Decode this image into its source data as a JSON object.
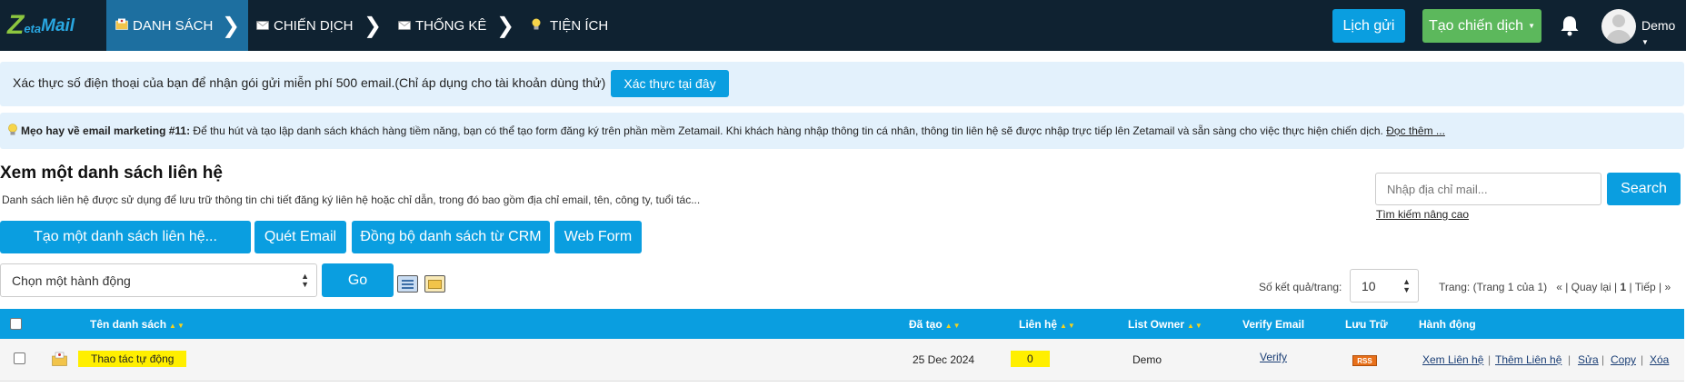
{
  "brand": {
    "logo_z": "Z",
    "logo_eta": "eta",
    "logo_mail": "Mail"
  },
  "nav": {
    "items": [
      {
        "label": "DANH SÁCH",
        "icon": "contacts-folder-icon",
        "active": true
      },
      {
        "label": "CHIẾN DỊCH",
        "icon": "envelope-icon",
        "active": false
      },
      {
        "label": "THỐNG KÊ",
        "icon": "envelope-icon",
        "active": false
      },
      {
        "label": "TIỆN ÍCH",
        "icon": "lightbulb-icon",
        "active": false
      }
    ]
  },
  "header": {
    "schedule_label": "Lịch gửi",
    "create_campaign_label": "Tạo chiến dịch",
    "user_name": "Demo"
  },
  "alert_verify": {
    "text": "Xác thực số điện thoại của bạn để nhận gói gửi miễn phí 500 email.(Chỉ áp dụng cho tài khoản dùng thử)",
    "button": "Xác thực tại đây"
  },
  "tip": {
    "title": "Mẹo hay về email marketing #11:",
    "text": " Để thu hút và tạo lập danh sách khách hàng tiềm năng, bạn có thể tạo form đăng ký trên phần mềm Zetamail. Khi khách hàng nhập thông tin cá nhân, thông tin liên hệ sẽ được nhập trực tiếp lên Zetamail và sẵn sàng cho việc thực hiện chiến dịch.",
    "more": "Đọc thêm ..."
  },
  "page": {
    "title": "Xem một danh sách liên hệ",
    "description": "Danh sách liên hệ được sử dụng để lưu trữ thông tin chi tiết đăng ký liên hệ hoặc chỉ dẫn, trong đó bao gồm địa chỉ email, tên, công ty, tuổi tác..."
  },
  "search": {
    "placeholder": "Nhập địa chỉ mail...",
    "button": "Search",
    "advanced": "Tìm kiếm nâng cao"
  },
  "actions": {
    "create_list": "Tạo một danh sách liên hệ...",
    "scan_email": "Quét Email",
    "sync_crm": "Đồng bộ danh sách từ CRM",
    "web_form": "Web Form",
    "bulk_select": "Chọn một hành động",
    "go": "Go"
  },
  "paging": {
    "per_page_label": "Số kết quả/trang:",
    "per_page_value": "10",
    "page_info": "Trang: (Trang 1 của 1)",
    "first": "«",
    "prev": "Quay lại",
    "current": "1",
    "next": "Tiếp",
    "last": "»"
  },
  "table": {
    "columns": {
      "name": "Tên danh sách",
      "created": "Đã tạo",
      "contacts": "Liên hệ",
      "owner": "List Owner",
      "verify": "Verify Email",
      "archive": "Lưu Trữ",
      "actions": "Hành động"
    },
    "rows": [
      {
        "name": "Thao tác tự động",
        "created": "25 Dec 2024",
        "contacts": "0",
        "owner": "Demo",
        "verify": "Verify",
        "archive": "RSS",
        "view": "Xem Liên hệ",
        "add": "Thêm Liên hệ",
        "edit": "Sửa",
        "copy": "Copy",
        "delete": "Xóa"
      }
    ]
  },
  "colors": {
    "topbar": "#0f2231",
    "nav_active": "#1d6fa0",
    "primary": "#0a9ee0",
    "success": "#5cb85c",
    "alert_bg": "#e3f1fc",
    "highlight": "#ffef00"
  }
}
